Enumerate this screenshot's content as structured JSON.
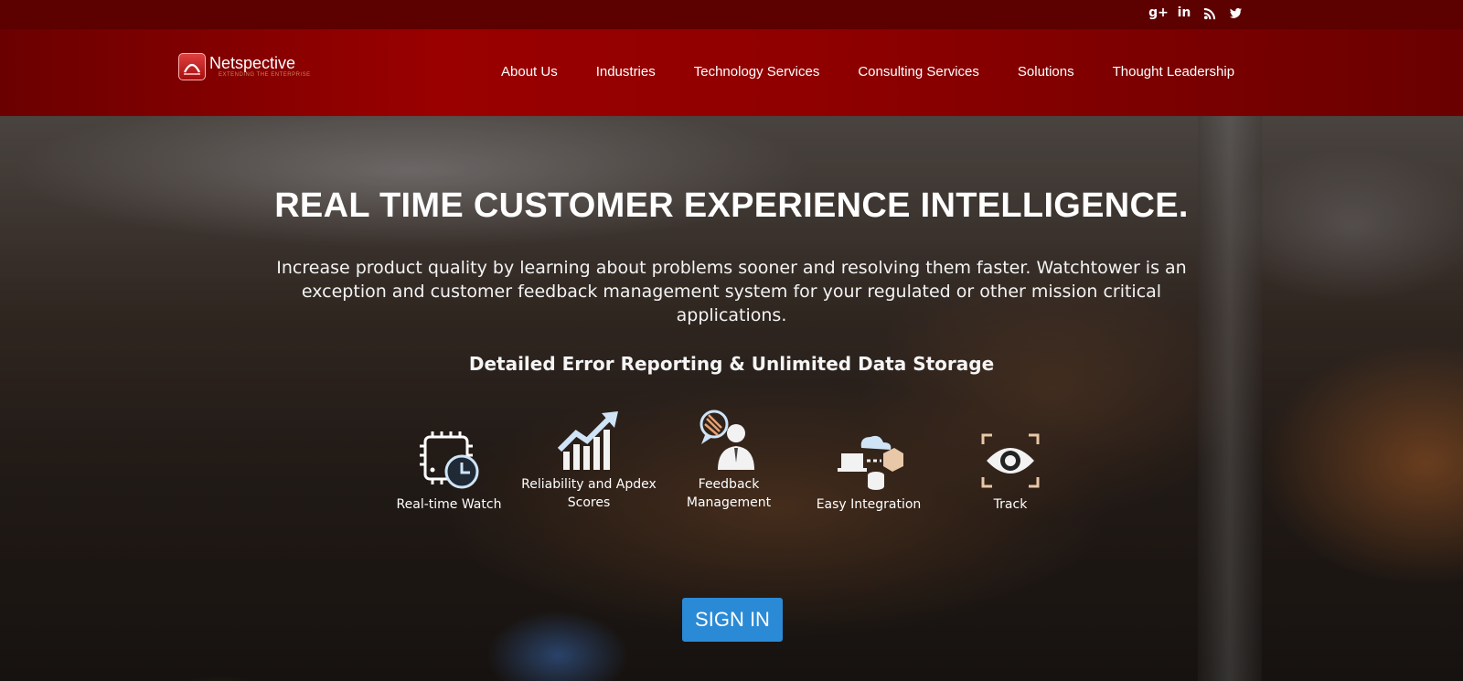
{
  "social": {
    "icons": [
      "google-plus-icon",
      "linkedin-icon",
      "rss-icon",
      "twitter-icon"
    ],
    "google_plus": "g+",
    "linkedin": "in"
  },
  "brand": {
    "name": "Netspective",
    "tagline": "EXTENDING THE ENTERPRISE",
    "colors": {
      "topbar": "#5c0000",
      "navbar": "#9a0000",
      "signin": "#2b8ad6"
    }
  },
  "nav": {
    "items": [
      {
        "label": "About Us"
      },
      {
        "label": "Industries"
      },
      {
        "label": "Technology Services"
      },
      {
        "label": "Consulting Services"
      },
      {
        "label": "Solutions"
      },
      {
        "label": "Thought Leadership"
      }
    ]
  },
  "hero": {
    "title": "REAL TIME CUSTOMER EXPERIENCE INTELLIGENCE.",
    "description": "Increase product quality by learning about problems sooner and resolving them faster. Watchtower is an exception and customer feedback management system for your regulated or other mission critical applications.",
    "subtitle": "Detailed Error Reporting & Unlimited Data Storage",
    "features": [
      {
        "label": "Real-time Watch",
        "icon": "chip-clock-icon"
      },
      {
        "label": "Reliability and Apdex Scores",
        "icon": "bar-chart-arrow-icon"
      },
      {
        "label": "Feedback Management",
        "icon": "feedback-person-icon"
      },
      {
        "label": "Easy Integration",
        "icon": "cloud-integration-icon"
      },
      {
        "label": "Track",
        "icon": "eye-track-icon"
      }
    ],
    "signin_label": "SIGN IN"
  }
}
